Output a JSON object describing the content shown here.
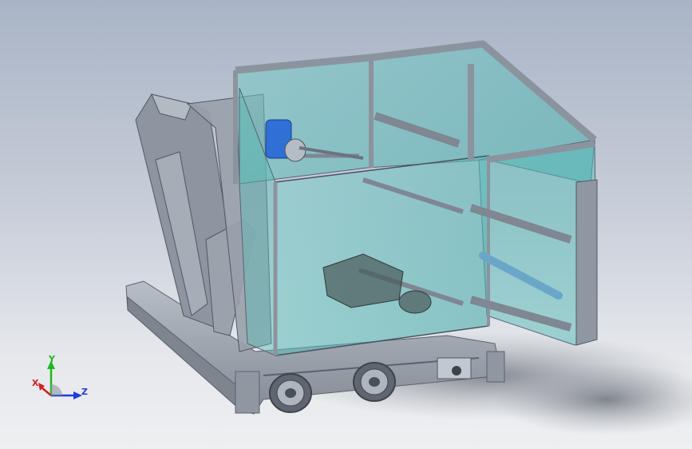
{
  "viewport": {
    "background_top": "#a9b4c6",
    "background_bottom": "#eeeff1",
    "model_colors": {
      "frame": "#9aa3ad",
      "frame_dark": "#6c7480",
      "glass": "#4fb7b4",
      "motor": "#2f6fd6"
    }
  },
  "triad": {
    "x_label": "X",
    "y_label": "Y",
    "z_label": "Z",
    "x_color": "#d21f1f",
    "y_color": "#1fb81f",
    "z_color": "#1f3fd6"
  }
}
